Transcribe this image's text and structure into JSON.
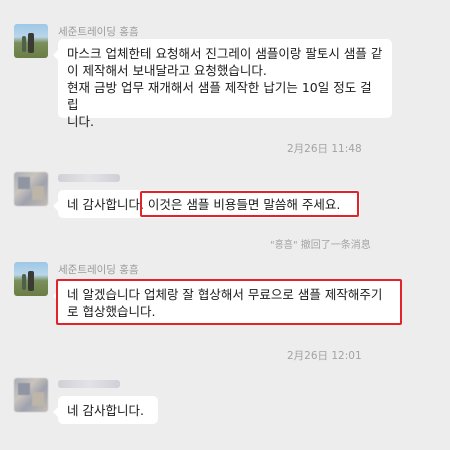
{
  "messages": [
    {
      "sender": "세준트레이딩 홍흠",
      "lines": [
        "마스크 업체한테 요청해서 진그레이 샘플이랑 팔토시 샘플 같",
        "이 제작해서 보내달라고 요청했습니다.",
        "현재 금방 업무 재개해서 샘플 제작한 납기는 10일 정도 걸립",
        "니다."
      ]
    },
    {
      "timestamp": "2月26日 11:48"
    },
    {
      "sender_redacted": true,
      "text_prefix": "네 감사합니다",
      "text_highlight": ". 이것은 샘플 비용들면 말씀해 주세요."
    },
    {
      "recall_notice": "\"홍흠\" 撤回了一条消息"
    },
    {
      "sender": "세준트레이딩 홍흠",
      "lines": [
        "네 알겠습니다 업체랑 잘 협상해서 무료으로 샘플 제작해주기",
        "로 협상했습니다."
      ]
    },
    {
      "timestamp": "2月26日 12:01"
    },
    {
      "sender_redacted": true,
      "text": "네 감사합니다."
    }
  ],
  "colors": {
    "background": "#ededed",
    "bubble": "#ffffff",
    "highlight_border": "#e0242a"
  }
}
